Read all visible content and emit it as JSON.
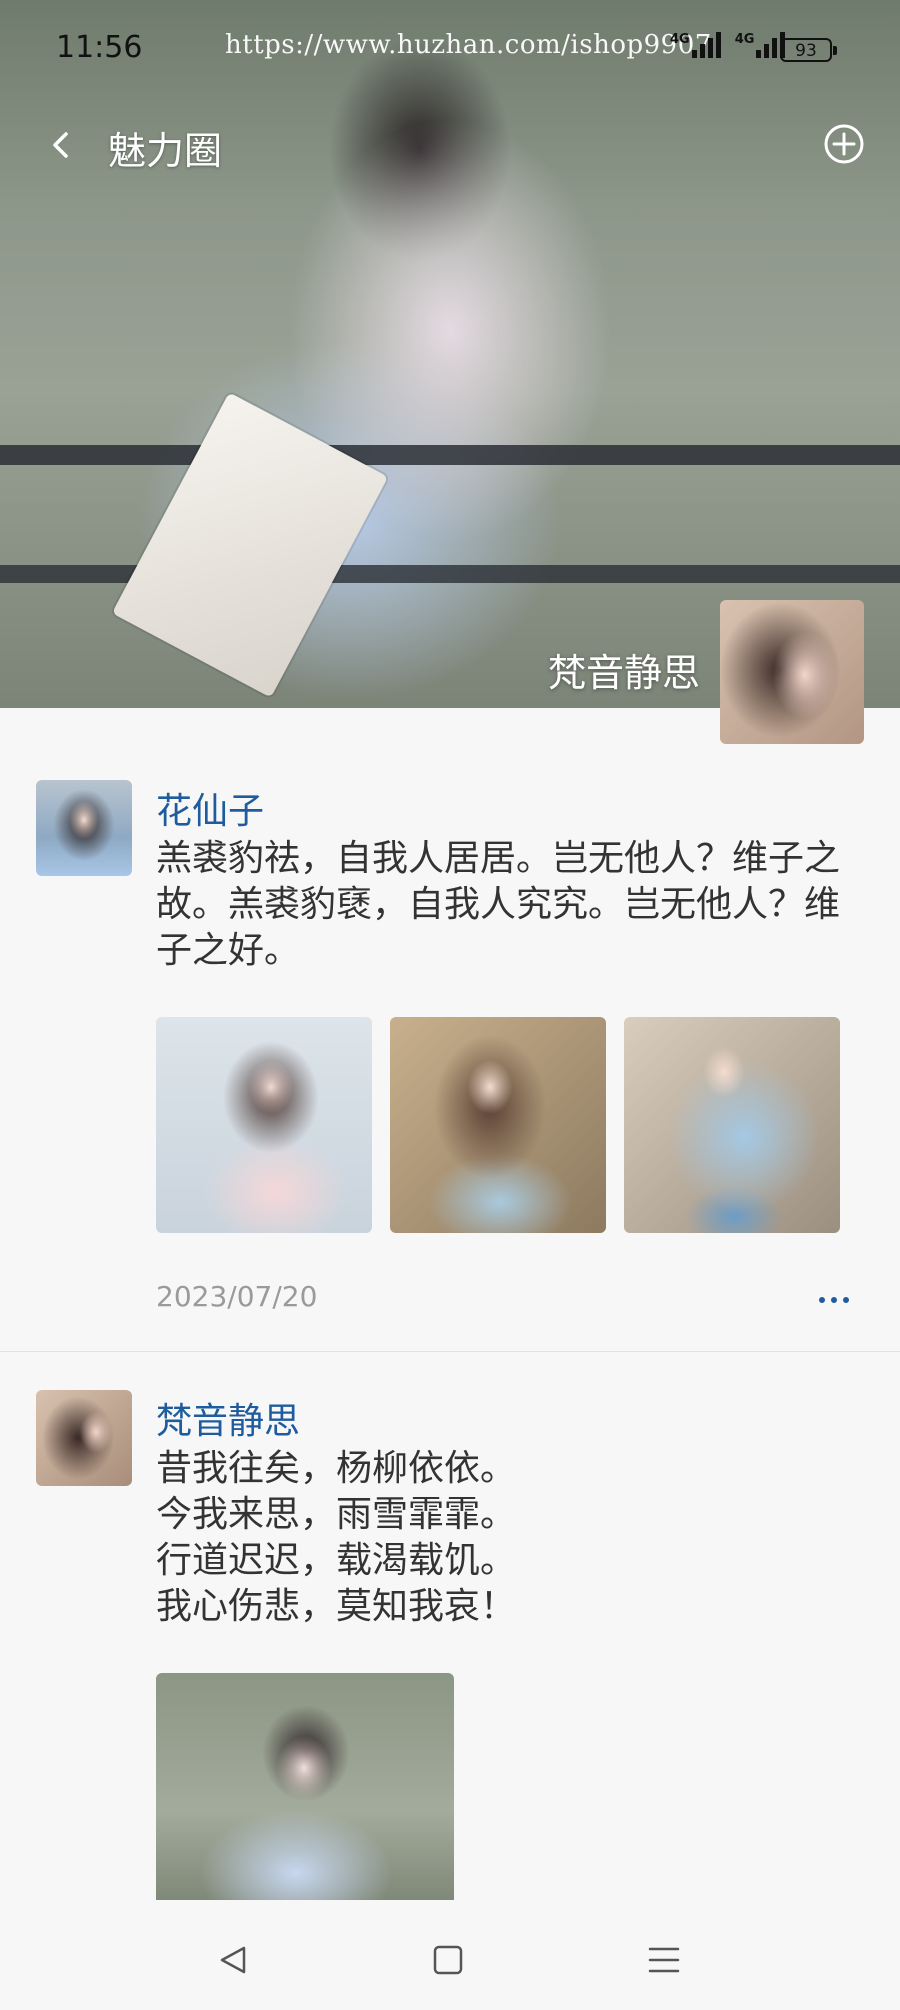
{
  "status_bar": {
    "time": "11:56",
    "watermark": "https://www.huzhan.com/ishop9907",
    "network_1": "4G",
    "network_2": "4G",
    "battery": "93"
  },
  "header": {
    "title": "魅力圈"
  },
  "cover": {
    "name": "梵音静思"
  },
  "posts": [
    {
      "author": "花仙子",
      "content": "羔裘豹祛，自我人居居。岂无他人？维子之故。羔裘豹褎，自我人究究。岂无他人？维子之好。",
      "date": "2023/07/20"
    },
    {
      "author": "梵音静思",
      "content_lines": [
        "昔我往矣，杨柳依依。",
        "今我来思，雨雪霏霏。",
        "行道迟迟，载渴载饥。",
        "我心伤悲，莫知我哀！"
      ]
    }
  ],
  "colors": {
    "accent": "#1f5c9e",
    "background": "#f7f7f7",
    "timestamp": "#9a9a9a"
  },
  "icons": {
    "back": "back-arrow-icon",
    "add": "add-circle-icon",
    "more": "more-dots-icon",
    "nav_back": "nav-back-icon",
    "nav_home": "nav-home-icon",
    "nav_menu": "nav-menu-icon"
  }
}
